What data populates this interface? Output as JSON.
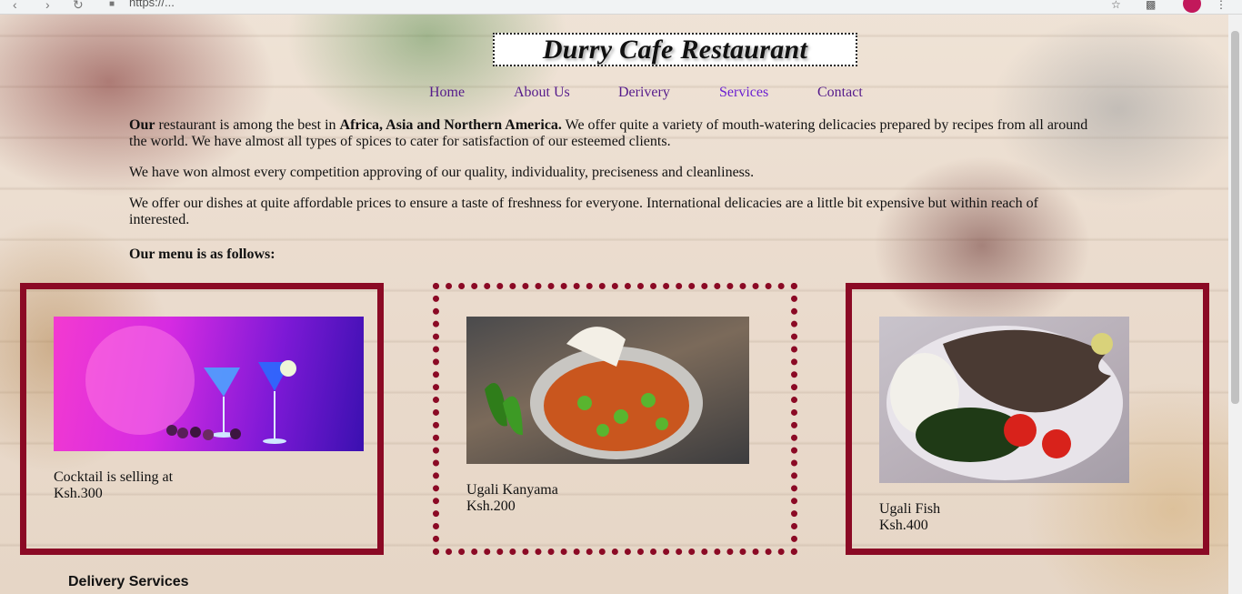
{
  "browser": {
    "url": "https://...",
    "back_icon": "back-arrow-icon",
    "forward_icon": "forward-arrow-icon",
    "reload_icon": "reload-icon",
    "lock_icon": "lock-icon"
  },
  "header": {
    "title": "Durry Cafe Restaurant"
  },
  "nav": {
    "items": [
      {
        "label": "Home",
        "color": "#551a8b"
      },
      {
        "label": "About Us",
        "color": "#551a8b"
      },
      {
        "label": "Derivery",
        "color": "#551a8b"
      },
      {
        "label": "Services",
        "color": "#6a1fd1"
      },
      {
        "label": "Contact",
        "color": "#551a8b"
      }
    ]
  },
  "intro": {
    "p1_lead": "Our",
    "p1_part1": " restaurant is among the best in ",
    "p1_bold": "Africa, Asia and Northern America.",
    "p1_part2": " We offer quite a variety of mouth-watering delicacies prepared by recipes from all around the world. We have almost all types of spices to cater for satisfaction of our esteemed clients.",
    "p2": "We have won almost every competition approving of our quality, individuality, preciseness and cleanliness.",
    "p3": "We offer our dishes at quite affordable prices to ensure a taste of freshness for everyone. International delicacies are a little bit expensive but within reach of interested.",
    "p4": "Our menu is as follows:"
  },
  "menu": [
    {
      "name": "Cocktail is selling at",
      "price": "Ksh.300",
      "image": "cocktail-image"
    },
    {
      "name": "Ugali Kanyama",
      "price": "Ksh.200",
      "image": "ugali-kanyama-image"
    },
    {
      "name": "Ugali Fish",
      "price": "Ksh.400",
      "image": "ugali-fish-image"
    }
  ],
  "colors": {
    "card_border": "#8b0a25"
  },
  "footer": {
    "section_heading": "Delivery Services"
  }
}
